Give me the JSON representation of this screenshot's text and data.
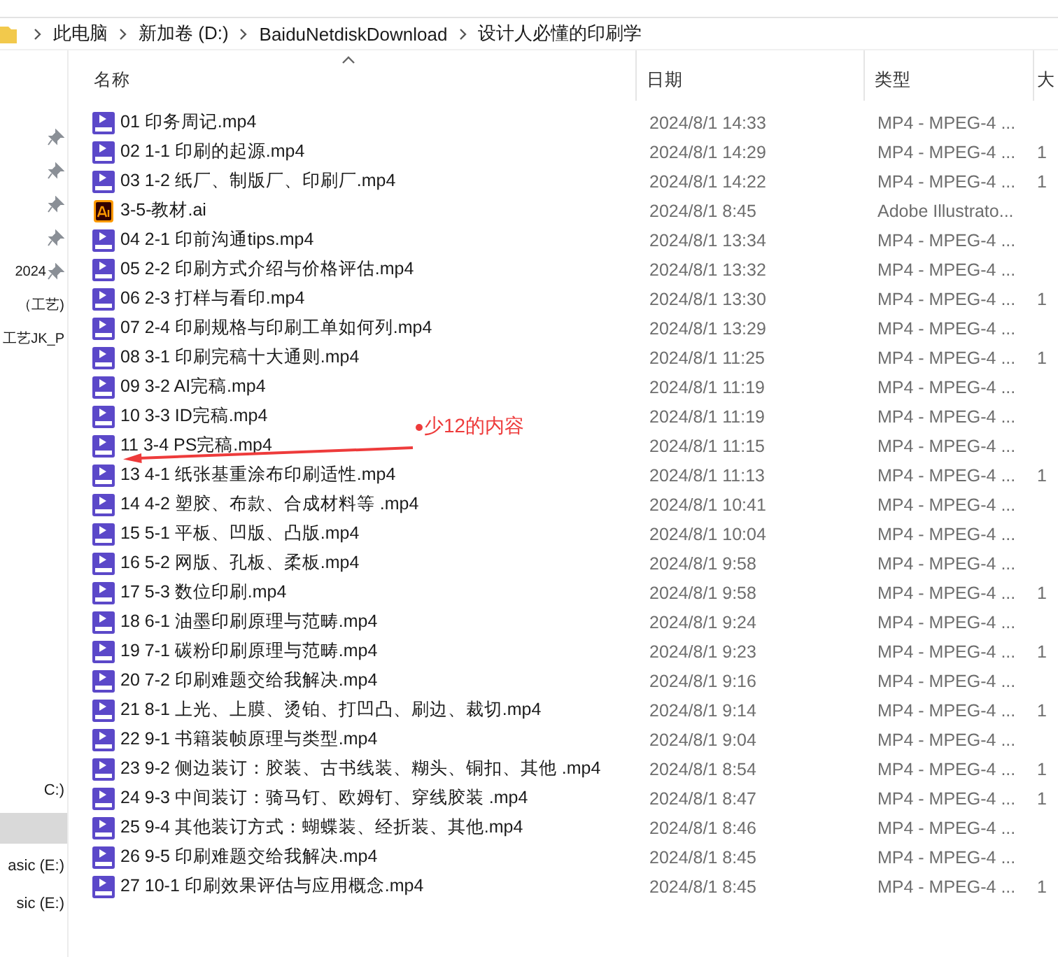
{
  "breadcrumb": [
    "此电脑",
    "新加卷 (D:)",
    "BaiduNetdiskDownload",
    "设计人必懂的印刷学"
  ],
  "sidebar": {
    "quick_access": [
      {
        "pinned": true
      },
      {
        "pinned": true
      },
      {
        "pinned": true
      },
      {
        "pinned": true
      },
      {
        "label": "2024",
        "pinned": true
      },
      {
        "label": "（工艺)",
        "pinned": false
      },
      {
        "label": "工艺JK_P",
        "pinned": false
      }
    ],
    "drives": [
      {
        "label": "C:)",
        "selected": false
      },
      {
        "selected": true
      },
      {
        "label": "asic (E:)",
        "selected": false
      },
      {
        "label": "sic (E:)",
        "selected": false
      }
    ]
  },
  "columns": [
    {
      "label": "名称",
      "sorted": true
    },
    {
      "label": "日期",
      "sorted": false
    },
    {
      "label": "类型",
      "sorted": false
    },
    {
      "label": "大",
      "sorted": false
    }
  ],
  "files": [
    {
      "kind": "video",
      "name": "01 印务周记.mp4",
      "date": "2024/8/1 14:33",
      "type": "MP4 - MPEG-4 ..."
    },
    {
      "kind": "video",
      "name": "02 1-1 印刷的起源.mp4",
      "date": "2024/8/1 14:29",
      "type": "MP4 - MPEG-4 ...",
      "column_4": "1"
    },
    {
      "kind": "video",
      "name": "03 1-2 纸厂、制版厂、印刷厂.mp4",
      "date": "2024/8/1 14:22",
      "type": "MP4 - MPEG-4 ...",
      "column_4": "1"
    },
    {
      "kind": "illustrator",
      "name": "3-5-教材.ai",
      "date": "2024/8/1 8:45",
      "type": "Adobe Illustrato..."
    },
    {
      "kind": "video",
      "name": "04 2-1 印前沟通tips.mp4",
      "date": "2024/8/1 13:34",
      "type": "MP4 - MPEG-4 ..."
    },
    {
      "kind": "video",
      "name": "05 2-2 印刷方式介绍与价格评估.mp4",
      "date": "2024/8/1 13:32",
      "type": "MP4 - MPEG-4 ..."
    },
    {
      "kind": "video",
      "name": "06 2-3 打样与看印.mp4",
      "date": "2024/8/1 13:30",
      "type": "MP4 - MPEG-4 ...",
      "column_4": "1"
    },
    {
      "kind": "video",
      "name": "07 2-4 印刷规格与印刷工单如何列.mp4",
      "date": "2024/8/1 13:29",
      "type": "MP4 - MPEG-4 ..."
    },
    {
      "kind": "video",
      "name": "08 3-1 印刷完稿十大通则.mp4",
      "date": "2024/8/1 11:25",
      "type": "MP4 - MPEG-4 ...",
      "column_4": "1"
    },
    {
      "kind": "video",
      "name": "09 3-2 AI完稿.mp4",
      "date": "2024/8/1 11:19",
      "type": "MP4 - MPEG-4 ..."
    },
    {
      "kind": "video",
      "name": "10 3-3 ID完稿.mp4",
      "date": "2024/8/1 11:19",
      "type": "MP4 - MPEG-4 ..."
    },
    {
      "kind": "video",
      "name": "11 3-4 PS完稿.mp4",
      "date": "2024/8/1 11:15",
      "type": "MP4 - MPEG-4 ..."
    },
    {
      "kind": "video",
      "name": "13 4-1 纸张基重涂布印刷适性.mp4",
      "date": "2024/8/1 11:13",
      "type": "MP4 - MPEG-4 ...",
      "column_4": "1"
    },
    {
      "kind": "video",
      "name": "14 4-2 塑胶、布款、合成材料等 .mp4",
      "date": "2024/8/1 10:41",
      "type": "MP4 - MPEG-4 ..."
    },
    {
      "kind": "video",
      "name": "15 5-1 平板、凹版、凸版.mp4",
      "date": "2024/8/1 10:04",
      "type": "MP4 - MPEG-4 ..."
    },
    {
      "kind": "video",
      "name": "16 5-2 网版、孔板、柔板.mp4",
      "date": "2024/8/1 9:58",
      "type": "MP4 - MPEG-4 ..."
    },
    {
      "kind": "video",
      "name": "17 5-3 数位印刷.mp4",
      "date": "2024/8/1 9:58",
      "type": "MP4 - MPEG-4 ...",
      "column_4": "1"
    },
    {
      "kind": "video",
      "name": "18 6-1 油墨印刷原理与范畴.mp4",
      "date": "2024/8/1 9:24",
      "type": "MP4 - MPEG-4 ..."
    },
    {
      "kind": "video",
      "name": "19 7-1 碳粉印刷原理与范畴.mp4",
      "date": "2024/8/1 9:23",
      "type": "MP4 - MPEG-4 ...",
      "column_4": "1"
    },
    {
      "kind": "video",
      "name": "20 7-2 印刷难题交给我解决.mp4",
      "date": "2024/8/1 9:16",
      "type": "MP4 - MPEG-4 ..."
    },
    {
      "kind": "video",
      "name": "21 8-1 上光、上膜、烫铂、打凹凸、刷边、裁切.mp4",
      "date": "2024/8/1 9:14",
      "type": "MP4 - MPEG-4 ...",
      "column_4": "1"
    },
    {
      "kind": "video",
      "name": "22 9-1 书籍装帧原理与类型.mp4",
      "date": "2024/8/1 9:04",
      "type": "MP4 - MPEG-4 ..."
    },
    {
      "kind": "video",
      "name": "23 9-2 侧边装订：胶装、古书线装、糊头、铜扣、其他 .mp4",
      "date": "2024/8/1 8:54",
      "type": "MP4 - MPEG-4 ...",
      "column_4": "1"
    },
    {
      "kind": "video",
      "name": "24 9-3 中间装订：骑马钉、欧姆钉、穿线胶装 .mp4",
      "date": "2024/8/1 8:47",
      "type": "MP4 - MPEG-4 ...",
      "column_4": "1"
    },
    {
      "kind": "video",
      "name": "25 9-4 其他装订方式：蝴蝶装、经折装、其他.mp4",
      "date": "2024/8/1 8:46",
      "type": "MP4 - MPEG-4 ..."
    },
    {
      "kind": "video",
      "name": "26 9-5 印刷难题交给我解决.mp4",
      "date": "2024/8/1 8:45",
      "type": "MP4 - MPEG-4 ..."
    },
    {
      "kind": "video",
      "name": "27 10-1 印刷效果评估与应用概念.mp4",
      "date": "2024/8/1 8:45",
      "type": "MP4 - MPEG-4 ...",
      "column_4": "1"
    }
  ],
  "annotation": {
    "text": "少12的内容"
  }
}
